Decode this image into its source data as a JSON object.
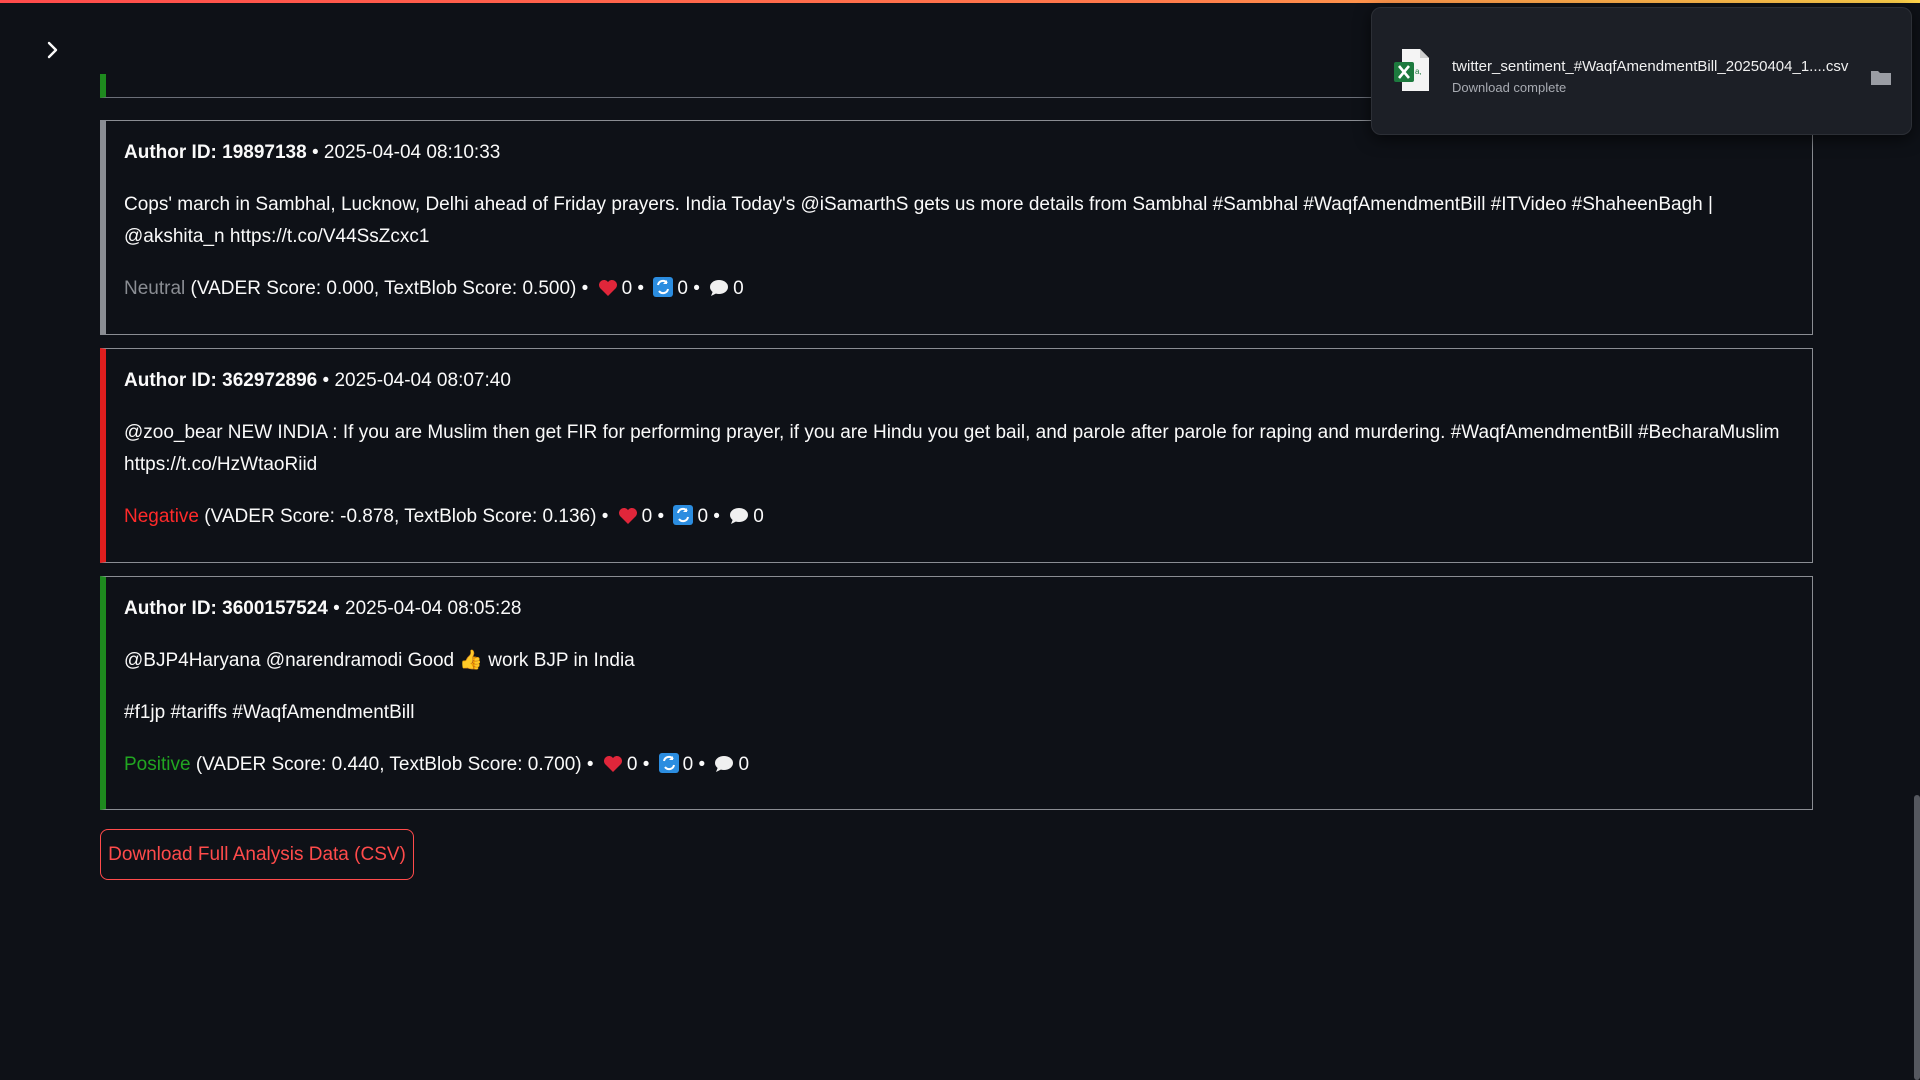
{
  "header": {
    "accent_gradient": [
      "#ff4b4b",
      "#ff7a4b",
      "#ffd34b"
    ]
  },
  "sidebar": {
    "toggle_icon": "chevron-right-icon"
  },
  "tweets": [
    {
      "author_label": "Author ID: 19897138",
      "separator": " • ",
      "timestamp": "2025-04-04 08:10:33",
      "text_lines": [
        "Cops' march in Sambhal, Lucknow, Delhi ahead of Friday prayers. India Today's @iSamarthS gets us more details from Sambhal #Sambhal #WaqfAmendmentBill #ITVideo #ShaheenBagh | @akshita_n https://t.co/V44SsZcxc1"
      ],
      "sentiment": "Neutral",
      "sentiment_color": "#8a8d93",
      "scores": "(VADER Score: 0.000, TextBlob Score: 0.500)",
      "likes": "0",
      "retweets": "0",
      "replies": "0"
    },
    {
      "author_label": "Author ID: 362972896",
      "separator": " • ",
      "timestamp": "2025-04-04 08:07:40",
      "text_lines": [
        "@zoo_bear NEW INDIA : If you are Muslim then get FIR for performing prayer, if you are Hindu you get bail, and parole after parole for raping and murdering. #WaqfAmendmentBill #BecharaMuslim https://t.co/HzWtaoRiid"
      ],
      "sentiment": "Negative",
      "sentiment_color": "#ff2a2a",
      "scores": "(VADER Score: -0.878, TextBlob Score: 0.136)",
      "likes": "0",
      "retweets": "0",
      "replies": "0"
    },
    {
      "author_label": "Author ID: 3600157524",
      "separator": " • ",
      "timestamp": "2025-04-04 08:05:28",
      "text_lines": [
        "@BJP4Haryana @narendramodi Good 👍 work BJP in India",
        "#f1jp #tariffs #WaqfAmendmentBill"
      ],
      "sentiment": "Positive",
      "sentiment_color": "#21a621",
      "scores": "(VADER Score: 0.440, TextBlob Score: 0.700)",
      "likes": "0",
      "retweets": "0",
      "replies": "0"
    }
  ],
  "meta_separator": " • ",
  "download_button": {
    "label": "Download Full Analysis Data (CSV)"
  },
  "download_popup": {
    "filename": "twitter_sentiment_#WaqfAmendmentBill_20250404_1....csv",
    "status": "Download complete",
    "file_icon": "excel-file-icon",
    "folder_icon": "folder-icon"
  }
}
